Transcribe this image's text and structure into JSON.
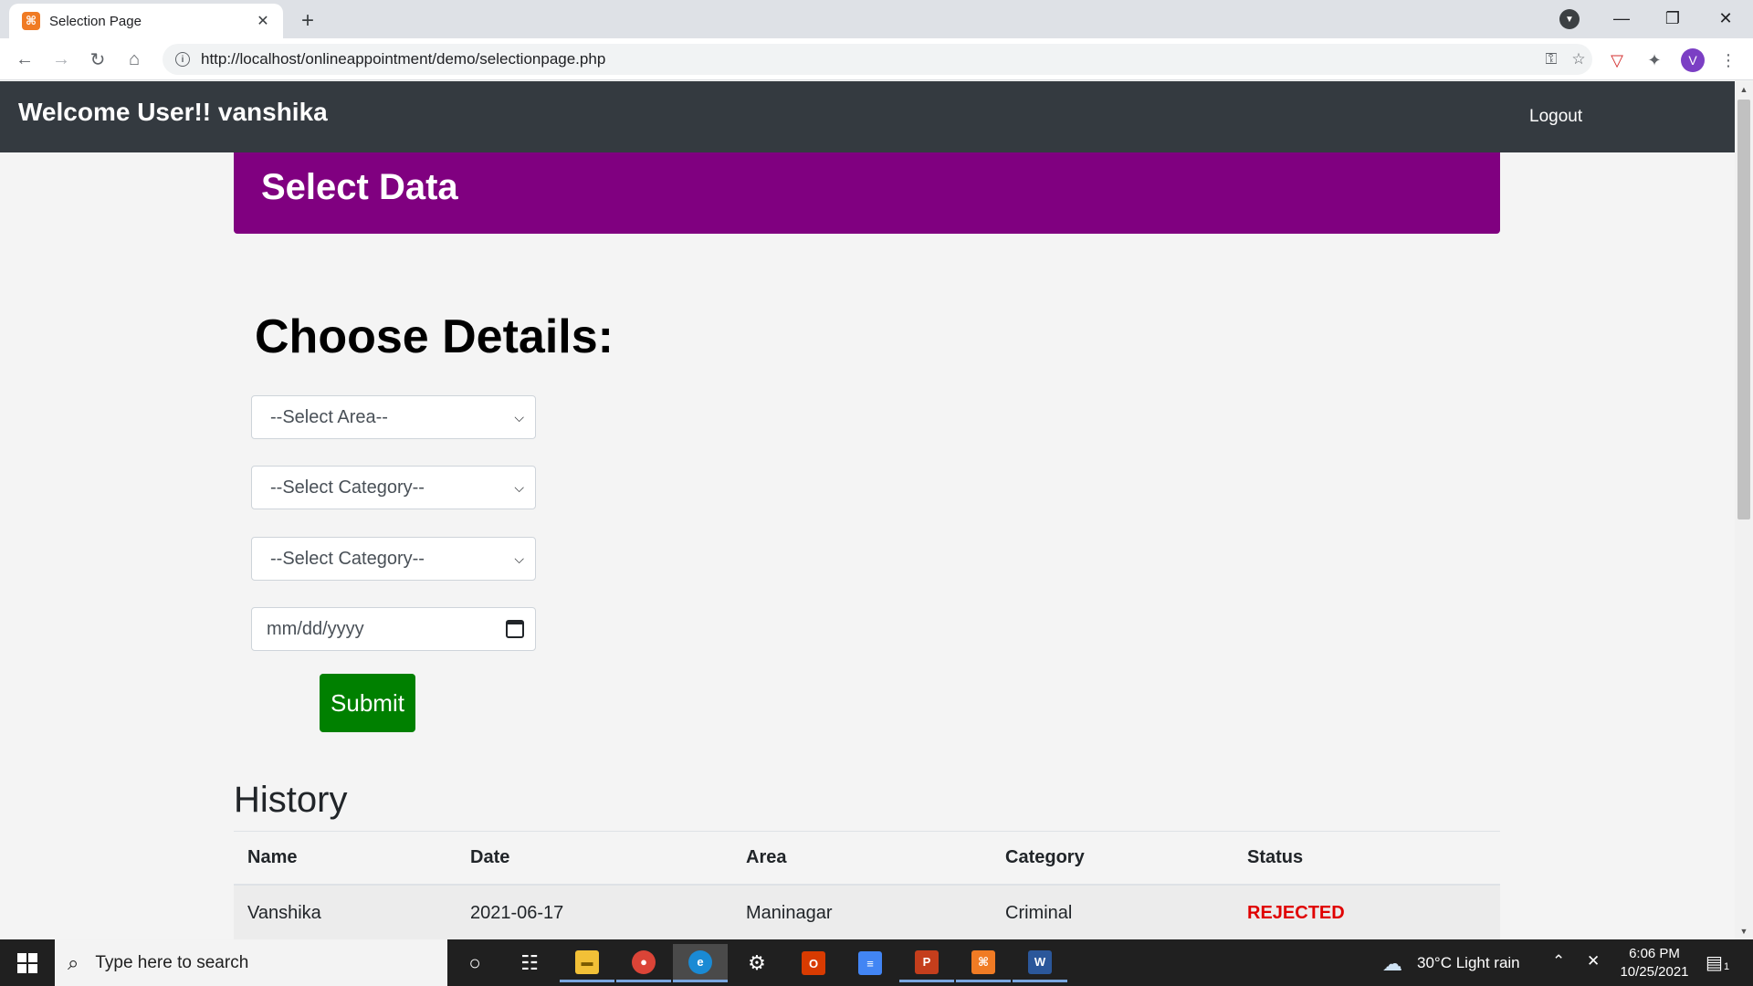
{
  "browser": {
    "tab_title": "Selection Page",
    "tab_favicon": "xampp-icon",
    "url_prefix": "http://",
    "url_host": "localhost",
    "url_path": "/onlineappointment/demo/selectionpage.php",
    "profile_initial": "V"
  },
  "navbar": {
    "brand": "Welcome User!! vanshika",
    "logout": "Logout"
  },
  "banner": {
    "title": "Select Data"
  },
  "form": {
    "heading": "Choose Details:",
    "area_select": "--Select Area--",
    "category_select_1": "--Select Category--",
    "category_select_2": "--Select Category--",
    "date_placeholder": "mm/dd/yyyy",
    "submit": "Submit"
  },
  "history": {
    "title": "History",
    "columns": [
      "Name",
      "Date",
      "Area",
      "Category",
      "Status"
    ],
    "rows": [
      [
        "Vanshika",
        "2021-06-17",
        "Maninagar",
        "Criminal",
        "REJECTED"
      ]
    ]
  },
  "taskbar": {
    "search_placeholder": "Type here to search",
    "weather": "30°C  Light rain",
    "time": "6:06 PM",
    "date": "10/25/2021",
    "notification_count": "1"
  },
  "colors": {
    "navbar": "#343a40",
    "banner": "#800080",
    "submit": "#008000",
    "rejected": "#e00000"
  }
}
